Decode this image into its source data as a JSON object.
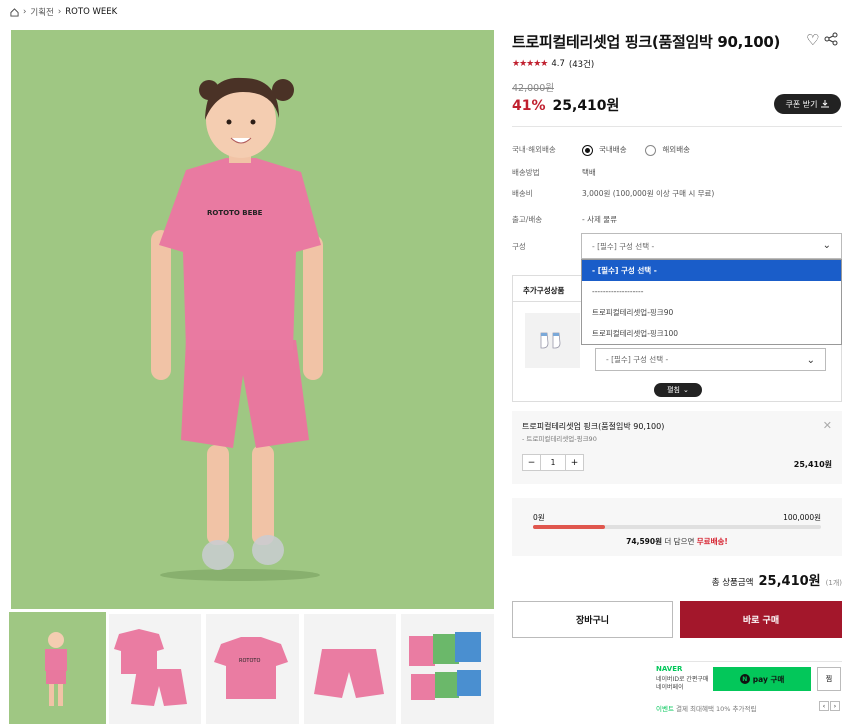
{
  "breadcrumb": {
    "home_icon": "home-icon",
    "items": [
      "기획전",
      "ROTO WEEK"
    ]
  },
  "product": {
    "title": "트로피컬테리셋업 핑크(품절임박 90,100)",
    "stars": "★★★★★",
    "rating": "4.7",
    "review_count": "(43건)",
    "original_price": "42,000원",
    "discount": "41%",
    "price": "25,410원",
    "coupon_label": "쿠폰 받기"
  },
  "info": {
    "shipping_type_label": "국내·해외배송",
    "domestic": "국내배송",
    "overseas": "해외배송",
    "method_label": "배송방법",
    "method": "택배",
    "fee_label": "배송비",
    "fee": "3,000원 (100,000원 이상 구매 시 무료)",
    "release_label": "출고/배송",
    "release": "- 사제 물류",
    "option_label": "구성"
  },
  "option_select": {
    "placeholder": "- [필수] 구성 선택 -"
  },
  "dropdown": {
    "options": [
      "- [필수] 구성 선택 -",
      "-------------------",
      "트로피컬테리셋업-핑크90",
      "트로피컬테리셋업-핑크100"
    ]
  },
  "extra": {
    "header": "추가구성상품",
    "select_placeholder": "- [필수] 구성 선택 -",
    "fold_label": "펼침"
  },
  "chosen": {
    "name": "트로피컬테리셋업 핑크(품절임박 90,100)",
    "option": "- 트로피컬테리셋업-핑크90",
    "qty": "1",
    "amount": "25,410원"
  },
  "shipping_progress": {
    "left": "0원",
    "right": "100,000원",
    "progress": 0.25,
    "msg_amount": "74,590원",
    "msg_mid": " 더 담으면 ",
    "msg_free": "무료배송!"
  },
  "total": {
    "label": "총 상품금액",
    "value": "25,410원",
    "count": "(1개)"
  },
  "buttons": {
    "cart": "장바구니",
    "buy": "바로 구매"
  },
  "npay": {
    "brand": "NAVER",
    "desc1": "네이버ID로 간편구매",
    "desc2": "네이버페이",
    "button": "pay 구매",
    "zzim": "찜",
    "event_label": "이벤트",
    "event": " 결제 최대혜택 10% 추가적립"
  },
  "colors": {
    "accent": "#c0202f",
    "buy": "#a3172b",
    "npay": "#03c75a",
    "image_bg": "#9fc783"
  }
}
